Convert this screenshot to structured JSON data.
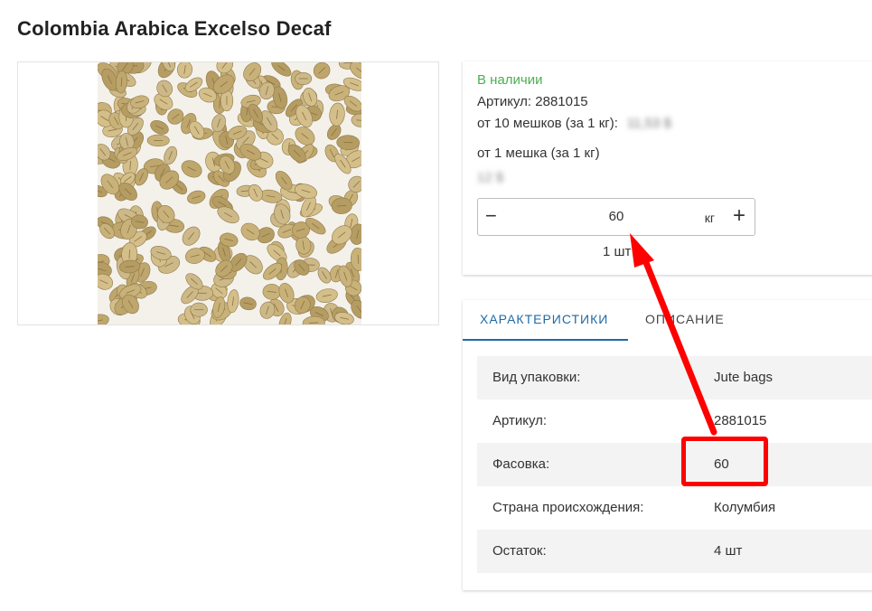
{
  "product": {
    "title": "Colombia Arabica Excelso Decaf"
  },
  "purchase": {
    "stock_status": "В наличии",
    "sku_line": "Артикул: 2881015",
    "price_bulk_label": "от 10 мешков (за 1 кг):",
    "price_bulk_value": "11,53 $",
    "price_single_label": "от 1 мешка (за 1 кг)",
    "price_single_value": "12 $",
    "quantity": {
      "minus": "−",
      "value": "60",
      "unit": "кг",
      "plus": "+"
    },
    "pieces": "1 шт"
  },
  "tabs": [
    {
      "label": "ХАРАКТЕРИСТИКИ",
      "active": true
    },
    {
      "label": "ОПИСАНИЕ",
      "active": false
    }
  ],
  "specs": [
    {
      "key": "Вид упаковки:",
      "value": "Jute bags"
    },
    {
      "key": "Артикул:",
      "value": "2881015"
    },
    {
      "key": "Фасовка:",
      "value": "60"
    },
    {
      "key": "Страна происхождения:",
      "value": "Колумбия"
    },
    {
      "key": "Остаток:",
      "value": "4 шт"
    }
  ],
  "colors": {
    "accent": "#1f6aa5",
    "stock": "#4caf50",
    "annotation": "#ff0000"
  },
  "icons": {
    "minus": "minus-icon",
    "plus": "plus-icon",
    "annotation_arrow": "arrow-icon"
  }
}
